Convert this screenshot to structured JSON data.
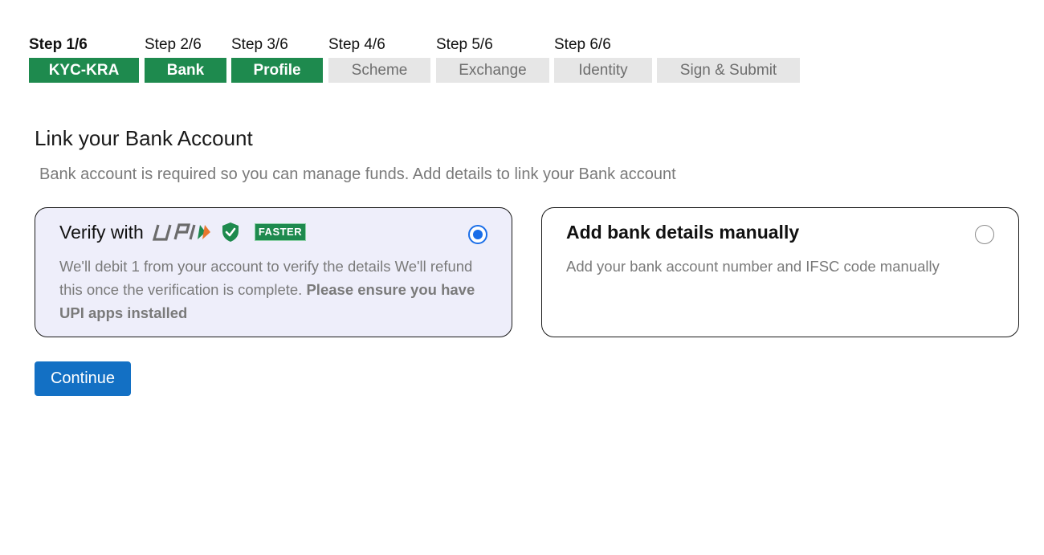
{
  "stepper": {
    "steps": [
      {
        "label": "Step 1/6",
        "name": "KYC-KRA",
        "status": "done",
        "current": true
      },
      {
        "label": "Step 2/6",
        "name": "Bank",
        "status": "done",
        "current": false
      },
      {
        "label": "Step 3/6",
        "name": "Profile",
        "status": "done",
        "current": false
      },
      {
        "label": "Step 4/6",
        "name": "Scheme",
        "status": "todo",
        "current": false
      },
      {
        "label": "Step 5/6",
        "name": "Exchange",
        "status": "todo",
        "current": false
      },
      {
        "label": "Step 6/6",
        "name": "Identity",
        "status": "todo",
        "current": false
      }
    ],
    "final_step": "Sign & Submit"
  },
  "page": {
    "title": "Link your Bank Account",
    "subtitle": "Bank account is required so you can manage funds. Add details to link your Bank account"
  },
  "options": {
    "upi": {
      "title": "Verify with",
      "logo_icon": "upi-logo-icon",
      "shield_icon": "verified-shield-icon",
      "badge": "FASTER",
      "desc_text": "We'll debit 1 from your account to verify the details We'll refund this once the verification is complete. ",
      "desc_bold": "Please ensure you have UPI apps installed",
      "selected": true
    },
    "manual": {
      "title": "Add bank details manually",
      "desc": "Add your bank account number and IFSC code manually",
      "selected": false
    }
  },
  "actions": {
    "continue_label": "Continue"
  },
  "colors": {
    "done_step": "#1e8a4e",
    "todo_step": "#e6e6e6",
    "primary": "#1370c4",
    "radio_selected": "#1a6ee8",
    "selected_card_bg": "#eeeefa"
  }
}
